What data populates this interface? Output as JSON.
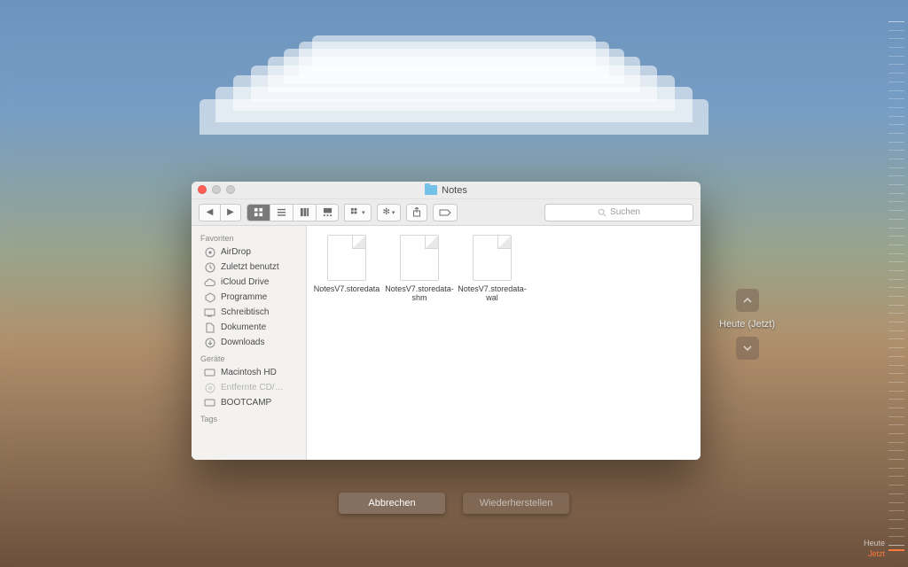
{
  "window": {
    "title": "Notes"
  },
  "toolbar": {
    "search_placeholder": "Suchen"
  },
  "sidebar": {
    "sections": [
      {
        "heading": "Favoriten",
        "items": [
          {
            "label": "AirDrop",
            "icon": "airdrop"
          },
          {
            "label": "Zuletzt benutzt",
            "icon": "clock"
          },
          {
            "label": "iCloud Drive",
            "icon": "cloud"
          },
          {
            "label": "Programme",
            "icon": "apps"
          },
          {
            "label": "Schreibtisch",
            "icon": "desktop"
          },
          {
            "label": "Dokumente",
            "icon": "doc"
          },
          {
            "label": "Downloads",
            "icon": "download"
          }
        ]
      },
      {
        "heading": "Geräte",
        "items": [
          {
            "label": "Macintosh HD",
            "icon": "disk"
          },
          {
            "label": "Entfernte CD/…",
            "icon": "disc",
            "dim": true
          },
          {
            "label": "BOOTCAMP",
            "icon": "disk"
          }
        ]
      },
      {
        "heading": "Tags",
        "items": []
      }
    ]
  },
  "files": [
    {
      "name": "NotesV7.storedata"
    },
    {
      "name": "NotesV7.storedata-shm"
    },
    {
      "name": "NotesV7.storedata-wal"
    }
  ],
  "timeline": {
    "current": "Heute (Jetzt)",
    "top_label": "Heute",
    "now_label": "Jetzt"
  },
  "buttons": {
    "cancel": "Abbrechen",
    "restore": "Wiederherstellen"
  }
}
